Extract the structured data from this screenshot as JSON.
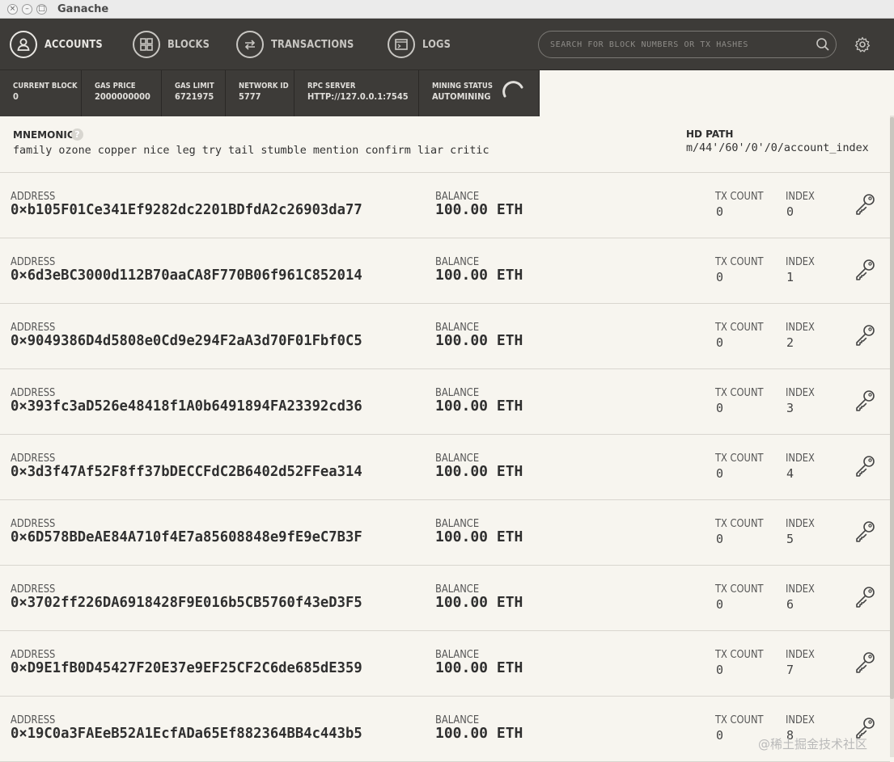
{
  "window": {
    "title": "Ganache"
  },
  "nav": {
    "items": [
      {
        "label": "ACCOUNTS",
        "icon": "user-icon",
        "active": true
      },
      {
        "label": "BLOCKS",
        "icon": "blocks-grid-icon",
        "active": false
      },
      {
        "label": "TRANSACTIONS",
        "icon": "transfer-arrows-icon",
        "active": false
      },
      {
        "label": "LOGS",
        "icon": "terminal-icon",
        "active": false
      }
    ],
    "search_placeholder": "SEARCH FOR BLOCK NUMBERS OR TX HASHES"
  },
  "stats": {
    "current_block": {
      "label": "CURRENT BLOCK",
      "value": "0"
    },
    "gas_price": {
      "label": "GAS PRICE",
      "value": "2000000000"
    },
    "gas_limit": {
      "label": "GAS LIMIT",
      "value": "6721975"
    },
    "network_id": {
      "label": "NETWORK ID",
      "value": "5777"
    },
    "rpc_server": {
      "label": "RPC SERVER",
      "value": "HTTP://127.0.0.1:7545"
    },
    "mining_status": {
      "label": "MINING STATUS",
      "value": "AUTOMINING"
    }
  },
  "mnemonic": {
    "label": "MNEMONIC",
    "help": "?",
    "words": "family ozone copper nice leg try tail stumble mention confirm liar critic",
    "hd_path_label": "HD PATH",
    "hd_path": "m/44'/60'/0'/0/account_index"
  },
  "labels": {
    "address": "ADDRESS",
    "balance": "BALANCE",
    "tx_count": "TX COUNT",
    "index": "INDEX"
  },
  "accounts": [
    {
      "address": "0×b105F01Ce341Ef9282dc2201BDfdA2c26903da77",
      "balance": "100.00 ETH",
      "tx_count": "0",
      "index": "0"
    },
    {
      "address": "0×6d3eBC3000d112B70aaCA8F770B06f961C852014",
      "balance": "100.00 ETH",
      "tx_count": "0",
      "index": "1"
    },
    {
      "address": "0×9049386D4d5808e0Cd9e294F2aA3d70F01Fbf0C5",
      "balance": "100.00 ETH",
      "tx_count": "0",
      "index": "2"
    },
    {
      "address": "0×393fc3aD526e48418f1A0b6491894FA23392cd36",
      "balance": "100.00 ETH",
      "tx_count": "0",
      "index": "3"
    },
    {
      "address": "0×3d3f47Af52F8ff37bDECCFdC2B6402d52FFea314",
      "balance": "100.00 ETH",
      "tx_count": "0",
      "index": "4"
    },
    {
      "address": "0×6D578BDeAE84A710f4E7a85608848e9fE9eC7B3F",
      "balance": "100.00 ETH",
      "tx_count": "0",
      "index": "5"
    },
    {
      "address": "0×3702ff226DA6918428F9E016b5CB5760f43eD3F5",
      "balance": "100.00 ETH",
      "tx_count": "0",
      "index": "6"
    },
    {
      "address": "0×D9E1fB0D45427F20E37e9EF25CF2C6de685dE359",
      "balance": "100.00 ETH",
      "tx_count": "0",
      "index": "7"
    },
    {
      "address": "0×19C0a3FAEeB52A1EcfADa65Ef882364BB4c443b5",
      "balance": "100.00 ETH",
      "tx_count": "0",
      "index": "8"
    }
  ],
  "watermark": "@稀土掘金技术社区"
}
